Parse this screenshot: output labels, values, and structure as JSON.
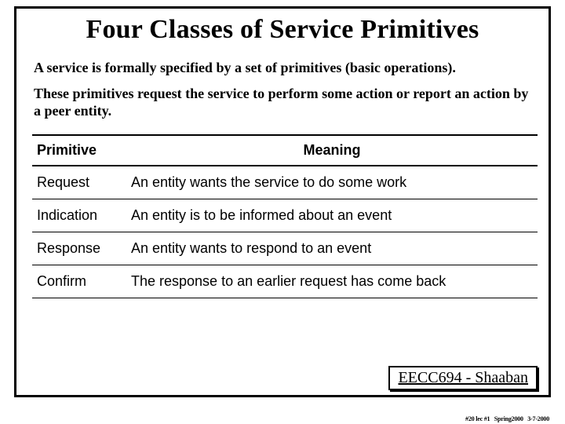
{
  "title": "Four Classes of Service Primitives",
  "paragraphs": {
    "p1": "A service is formally specified by a set of primitives (basic operations).",
    "p2": "These primitives request the service to perform some action or report an action by a peer entity."
  },
  "table": {
    "headers": {
      "primitive": "Primitive",
      "meaning": "Meaning"
    },
    "rows": [
      {
        "primitive": "Request",
        "meaning": "An entity wants the service to do some work"
      },
      {
        "primitive": "Indication",
        "meaning": "An entity is to be informed about an event"
      },
      {
        "primitive": "Response",
        "meaning": "An entity wants to respond to an event"
      },
      {
        "primitive": "Confirm",
        "meaning": "The response to an earlier request has come back"
      }
    ]
  },
  "footer": {
    "course": "EECC694 - Shaaban",
    "tiny": "#20 lec #1   Spring2000   3-7-2000"
  }
}
